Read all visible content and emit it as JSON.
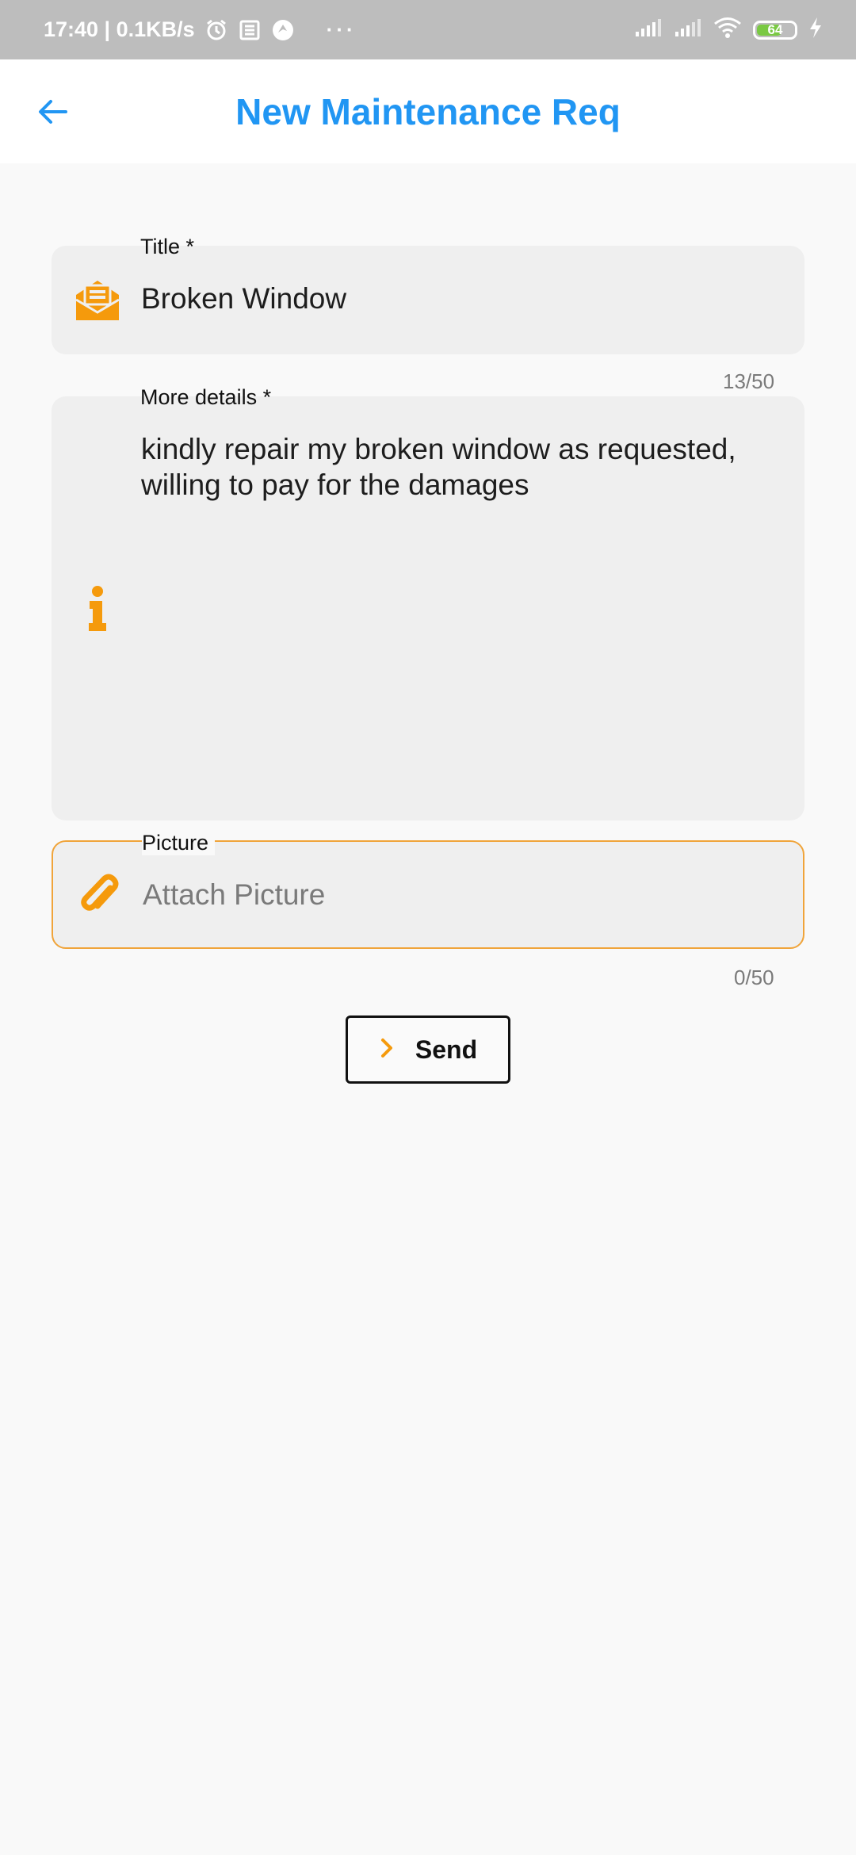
{
  "status_bar": {
    "time_speed": "17:40 | 0.1KB/s",
    "battery": "64",
    "dots": "···",
    "icons": [
      "alarm-icon",
      "news-icon",
      "app-icon",
      "signal-icon",
      "signal-icon",
      "wifi-icon",
      "battery-icon",
      "charging-icon"
    ]
  },
  "app_bar": {
    "title": "New Maintenance Req",
    "back_icon": "arrow-left-icon"
  },
  "form": {
    "title_field": {
      "label": "Title *",
      "value": "Broken Window",
      "counter": "13/50",
      "icon": "mail-open-icon"
    },
    "details_field": {
      "label": "More details *",
      "value": "kindly repair my broken window as requested, willing to pay for the damages",
      "icon": "info-icon"
    },
    "picture_field": {
      "label": "Picture",
      "placeholder": "Attach Picture",
      "counter": "0/50",
      "icon": "paperclip-icon"
    },
    "send_button": {
      "label": "Send",
      "icon": "chevron-right-icon"
    }
  },
  "colors": {
    "accent_blue": "#2196f3",
    "accent_orange": "#f59a0c",
    "field_bg": "#efefef",
    "page_bg": "#f9f9f9"
  }
}
